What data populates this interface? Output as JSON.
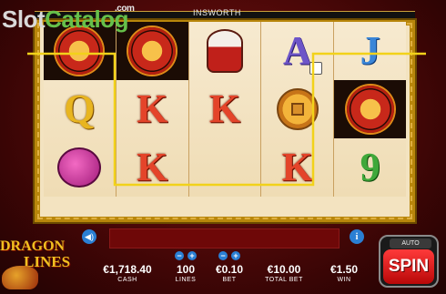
{
  "watermark": {
    "part1": "Slot",
    "part2": "Catalog",
    "suffix": ".com"
  },
  "brand": "INSWORTH",
  "game_logo": {
    "line1": "DRAGON",
    "line2": "LINES"
  },
  "reels": [
    [
      "yin-yang-dragon",
      "Q",
      "lantern"
    ],
    [
      "yin-yang-dragon",
      "K",
      "K"
    ],
    [
      "drum",
      "K",
      ""
    ],
    [
      "A",
      "coin",
      "K"
    ],
    [
      "J",
      "yin-yang-dragon",
      "9"
    ]
  ],
  "payline_color": "#f2d21a",
  "stats": {
    "cash_value": "€1,718.40",
    "cash_label": "CASH",
    "lines_value": "100",
    "lines_label": "LINES",
    "bet_value": "€0.10",
    "bet_label": "BET",
    "total_value": "€10.00",
    "total_label": "TOTAL BET",
    "win_value": "€1.50",
    "win_label": "WIN"
  },
  "buttons": {
    "auto": "AUTO",
    "spin": "SPIN",
    "minus": "−",
    "plus": "+",
    "info": "i",
    "sound": "◀)"
  }
}
